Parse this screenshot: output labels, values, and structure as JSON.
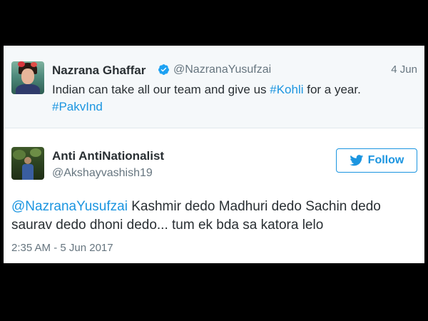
{
  "tweet1": {
    "name": "Nazrana Ghaffar",
    "handle": "@NazranaYusufzai",
    "date": "4 Jun",
    "text_before": "Indian can take all our team and give us ",
    "hashtag1": "#Kohli",
    "text_after": " for a year.",
    "hashtag2": "#PakvInd",
    "verified_color": "#1da1f2"
  },
  "tweet2": {
    "name": "Anti AntiNationalist",
    "handle": "@Akshayvashish19",
    "follow_label": "Follow",
    "mention": "@NazranaYusufzai",
    "text": " Kashmir dedo Madhuri dedo Sachin dedo saurav dedo dhoni dedo... tum ek bda sa katora lelo",
    "timestamp": "2:35 AM - 5 Jun 2017"
  },
  "colors": {
    "link": "#1b95e0",
    "text": "#292f33",
    "muted": "#66757f",
    "background": "#000000"
  },
  "icons": [
    "verified-badge-icon",
    "twitter-bird-icon"
  ]
}
